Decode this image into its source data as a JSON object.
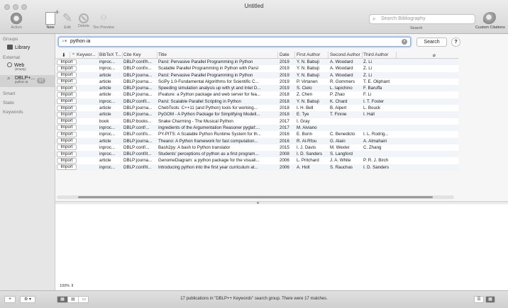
{
  "window": {
    "title": "Untitled"
  },
  "toolbar": {
    "buttons": [
      {
        "label": "Action",
        "icon": "gear-icon"
      },
      {
        "label": "New",
        "icon": "new-document-icon"
      },
      {
        "label": "Edit",
        "icon": "pencil-icon"
      },
      {
        "label": "Delete",
        "icon": "delete-icon"
      },
      {
        "label": "Tex Preview",
        "icon": "glasses-icon"
      }
    ],
    "search_placeholder": "Search Bibliography",
    "search_label": "Search",
    "custom_citations_label": "Custom Citations"
  },
  "sidebar": {
    "groups_header": "Groups",
    "library_label": "Library",
    "external_header": "External",
    "web_label": "Web",
    "web_sub": "(Empty)",
    "dblp_label": "DBLP+...",
    "dblp_sub": "python ia",
    "dblp_count": "17",
    "smart_header": "Smart",
    "static_header": "Static",
    "keywords_header": "Keywords"
  },
  "main": {
    "search_value": "python ia",
    "search_button": "Search",
    "help_button": "?",
    "zoom": "100%"
  },
  "table": {
    "columns": [
      "Keywor...",
      "BibTeX T...",
      "Cite Key",
      "Title",
      "Date",
      "First Author",
      "Second Author",
      "Third Author"
    ],
    "import_label": "Import",
    "rows": [
      [
        "inproc...",
        "DBLP:conf/h...",
        "Parsl: Pervasive Parallel Programming in Python",
        "2019",
        "Y. N. Babuji",
        "A. Woodard",
        "Z. Li"
      ],
      [
        "inproc...",
        "DBLP:conf/x...",
        "Scalable Parallel Programming in Python with Parsl",
        "2019",
        "Y. N. Babuji",
        "A. Woodard",
        "Z. Li"
      ],
      [
        "article",
        "DBLP:journa...",
        "Parsl: Pervasive Parallel Programming in Python",
        "2019",
        "Y. N. Babuji",
        "A. Woodard",
        "Z. Li"
      ],
      [
        "article",
        "DBLP:journa...",
        "SciPy 1.0-Fundamental Algorithms for Scientific C...",
        "2019",
        "P. Virtanen",
        "R. Gommers",
        "T. E. Oliphant"
      ],
      [
        "article",
        "DBLP:journa...",
        "Speeding simulation analysis up with yt and Intel D...",
        "2019",
        "S. Cielo",
        "L. Iapichino",
        "F. Baruffa"
      ],
      [
        "article",
        "DBLP:journa...",
        "iFeature: a Python package and web server for fea...",
        "2018",
        "Z. Chen",
        "P. Zhao",
        "F. Li"
      ],
      [
        "inproc...",
        "DBLP:conf/i...",
        "Parsl: Scalable Parallel Scripting in Python",
        "2018",
        "Y. N. Babuji",
        "K. Chard",
        "I. T. Foster"
      ],
      [
        "article",
        "DBLP:journa...",
        "ChebTools: C++11 (and Python) tools for working...",
        "2018",
        "I. H. Bell",
        "B. Alpert",
        "L. Bouck"
      ],
      [
        "article",
        "DBLP:journa...",
        "PyGOM - A Python Package for Simplifying Modell...",
        "2018",
        "E. Tye",
        "T. Finnie",
        "I. Hall"
      ],
      [
        "book",
        "DBLP:books...",
        "Snake Charming - The Musical Python",
        "2017",
        "I. Gray",
        "",
        ""
      ],
      [
        "inproc...",
        "DBLP:conf/...",
        "Ingredients of the Argumentation Reasoner pyglaf:...",
        "2017",
        "M. Alviano",
        "",
        ""
      ],
      [
        "inproc...",
        "DBLP:conf/s...",
        "PY-PITS: A Scalable Python Runtime System for th...",
        "2016",
        "E. Borin",
        "C. Benedicto",
        "I. L. Rodrig..."
      ],
      [
        "article",
        "DBLP:journa...",
        "Theano: A Python framework for fast computation...",
        "2016",
        "R. Al-Rfou",
        "G. Alain",
        "A. Almahairi"
      ],
      [
        "inproc...",
        "DBLP:conf/...",
        "Bash2py: A bash to Python translator",
        "2015",
        "I. J. Davis",
        "M. Wexler",
        "C. Zhang"
      ],
      [
        "inproc...",
        "DBLP:conf/it...",
        "Students' perceptions of python as a first program...",
        "2008",
        "I. D. Sanders",
        "S. Langford",
        ""
      ],
      [
        "article",
        "DBLP:journa...",
        "GenomeDiagram: a python package for the visuali...",
        "2006",
        "L. Pritchard",
        "J. A. White",
        "P. R. J. Birch"
      ],
      [
        "inproc...",
        "DBLP:conf/it...",
        "Introducing python into the first year curriculum at...",
        "2006",
        "A. Holt",
        "S. Rauchas",
        "I. D. Sanders"
      ]
    ]
  },
  "statusbar": {
    "text": "17 publications in \"DBLP++ Keywords\" search group. There were 17 matches.",
    "add_button": "+",
    "action_button": "⚙ ▾"
  }
}
